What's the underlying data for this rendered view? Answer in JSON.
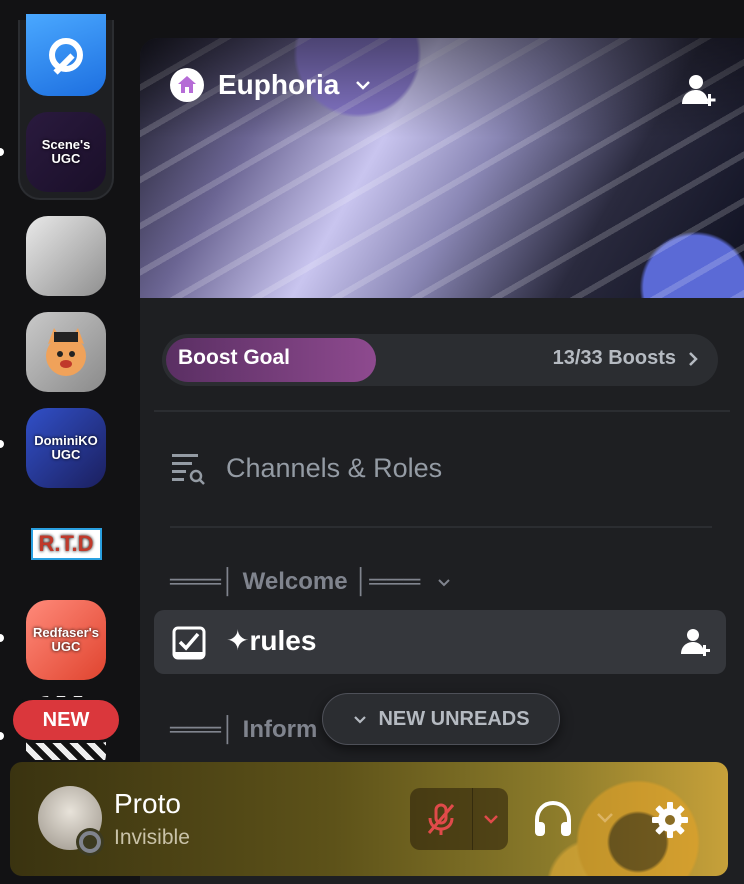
{
  "rail": {
    "servers": [
      {
        "name": "tools-server",
        "label": ""
      },
      {
        "name": "scenes-ugc-server",
        "label": "Scene's UGC"
      },
      {
        "name": "anime-server",
        "label": ""
      },
      {
        "name": "cat-server",
        "label": ""
      },
      {
        "name": "dominiko-ugc-server",
        "label": "DominiKO UGC"
      },
      {
        "name": "rtd-server",
        "label": "R.T.D"
      },
      {
        "name": "redfaser-ugc-server",
        "label": "Redfaser's UGC"
      },
      {
        "name": "striped-server",
        "label": ""
      }
    ],
    "new_badge": "NEW"
  },
  "server": {
    "name": "Euphoria",
    "boost": {
      "label": "Boost Goal",
      "count": "13/33 Boosts",
      "progress": 0.39
    },
    "browse_label": "Channels & Roles",
    "categories": [
      {
        "label": "═══│ Welcome │═══"
      },
      {
        "label": "═══│ Inform"
      }
    ],
    "channel": {
      "name": "✦rules"
    },
    "new_unreads": "NEW UNREADS"
  },
  "user": {
    "name": "Proto",
    "status": "Invisible"
  },
  "colors": {
    "accent_red": "#da373c",
    "boost_fill": "#8e4a8f",
    "panel_bg": "#1e1f22"
  }
}
